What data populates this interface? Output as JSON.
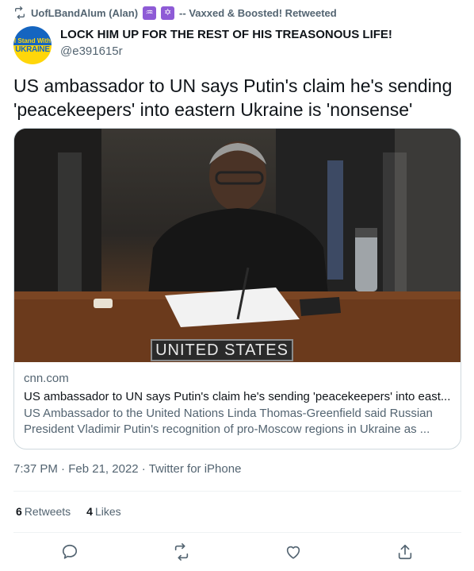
{
  "retweet": {
    "icon": "retweet-icon",
    "user": "UofLBandAlum (Alan)",
    "emoji_1": "♒",
    "emoji_2": "✡",
    "suffix": "-- Vaxxed & Boosted! Retweeted"
  },
  "author": {
    "avatar_line1": "I Stand With",
    "avatar_line2": "UKRAINE",
    "display_name": "LOCK HIM UP FOR THE REST OF HIS TREASONOUS LIFE!",
    "handle": "@e391615r"
  },
  "tweet": {
    "text": "US ambassador to UN says Putin's claim he's sending 'peacekeepers' into eastern Ukraine is 'nonsense'"
  },
  "card": {
    "nameplate": "UNITED STATES",
    "domain": "cnn.com",
    "title": "US ambassador to UN says Putin's claim he's sending 'peacekeepers' into east...",
    "description": "US Ambassador to the United Nations Linda Thomas-Greenfield said Russian President Vladimir Putin's recognition of pro-Moscow regions in Ukraine as ..."
  },
  "meta": {
    "time": "7:37 PM",
    "sep1": " · ",
    "date": "Feb 21, 2022",
    "sep2": " · ",
    "source": "Twitter for iPhone"
  },
  "stats": {
    "retweets_count": "6",
    "retweets_label": "Retweets",
    "likes_count": "4",
    "likes_label": "Likes"
  },
  "actions": [
    "reply-icon",
    "retweet-icon",
    "like-icon",
    "share-icon"
  ],
  "colors": {
    "text_primary": "#0f1419",
    "text_secondary": "#536471",
    "border": "#cfd9de",
    "avatar_blue": "#1565c0",
    "avatar_yellow": "#ffd60a",
    "emoji_purple": "#8e5bd6"
  }
}
